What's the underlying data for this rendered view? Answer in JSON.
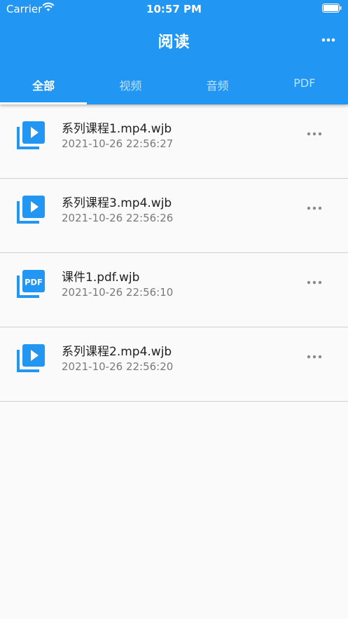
{
  "status_bar": {
    "carrier": "Carrier",
    "time": "10:57 PM"
  },
  "header": {
    "title": "阅读",
    "more_icon": "more-horiz-icon"
  },
  "tabs": [
    {
      "label": "全部",
      "active": true
    },
    {
      "label": "视频",
      "active": false
    },
    {
      "label": "音频",
      "active": false
    },
    {
      "label": "PDF",
      "active": false
    }
  ],
  "files": [
    {
      "name": "系列课程1.mp4.wjb",
      "time": "2021-10-26 22:56:27",
      "icon": "video-library-icon"
    },
    {
      "name": "系列课程3.mp4.wjb",
      "time": "2021-10-26 22:56:26",
      "icon": "video-library-icon"
    },
    {
      "name": "课件1.pdf.wjb",
      "time": "2021-10-26 22:56:10",
      "icon": "pdf-icon",
      "icon_text": "PDF"
    },
    {
      "name": "系列课程2.mp4.wjb",
      "time": "2021-10-26 22:56:20",
      "icon": "video-library-icon"
    }
  ],
  "colors": {
    "primary": "#2196f3",
    "background": "#fafafa",
    "divider": "#cfcfcf",
    "secondary_text": "#7a7a7a",
    "more_dots": "#8a8a8a"
  }
}
